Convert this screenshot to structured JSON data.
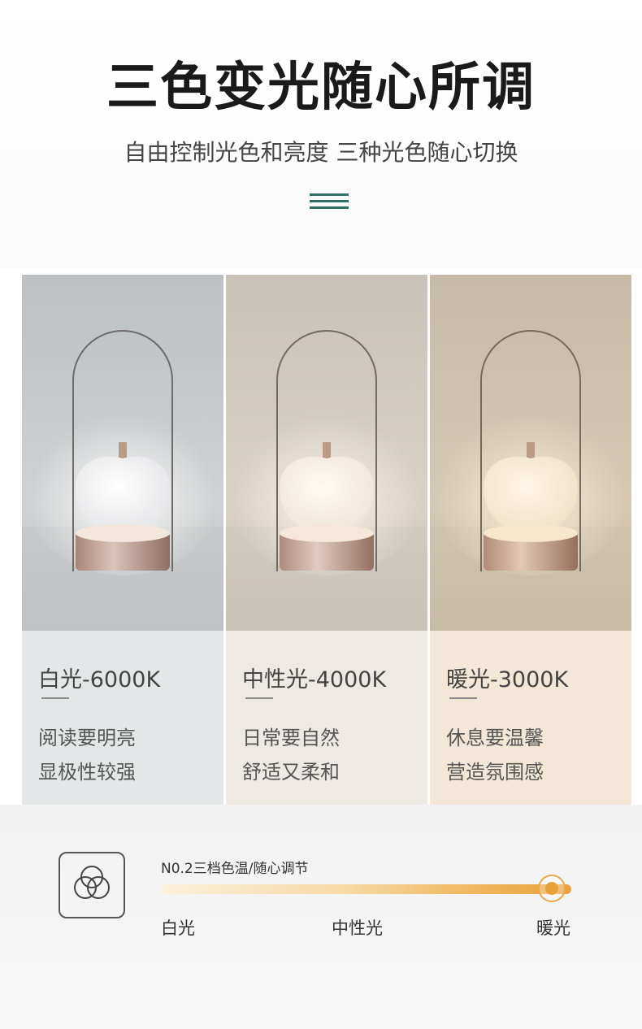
{
  "header": {
    "title": "三色变光随心所调",
    "subtitle": "自由控制光色和亮度 三种光色随心切换"
  },
  "panels": [
    {
      "temp_label": "白光-6000K",
      "line1": "阅读要明亮",
      "line2": "显极性较强",
      "bg_color": "#e4e7e8"
    },
    {
      "temp_label": "中性光-4000K",
      "line1": "日常要自然",
      "line2": "舒适又柔和",
      "bg_color": "#efe9e3"
    },
    {
      "temp_label": "暖光-3000K",
      "line1": "休息要温馨",
      "line2": "营造氛围感",
      "bg_color": "#f3e8d7"
    }
  ],
  "control": {
    "label": "N0.2三档色温/随心调节",
    "stops": [
      "白光",
      "中性光",
      "暖光"
    ],
    "selected": "暖光",
    "icon": "three-circles-icon"
  },
  "colors": {
    "accent": "#2f6f64",
    "slider_warm": "#eaa13d"
  }
}
